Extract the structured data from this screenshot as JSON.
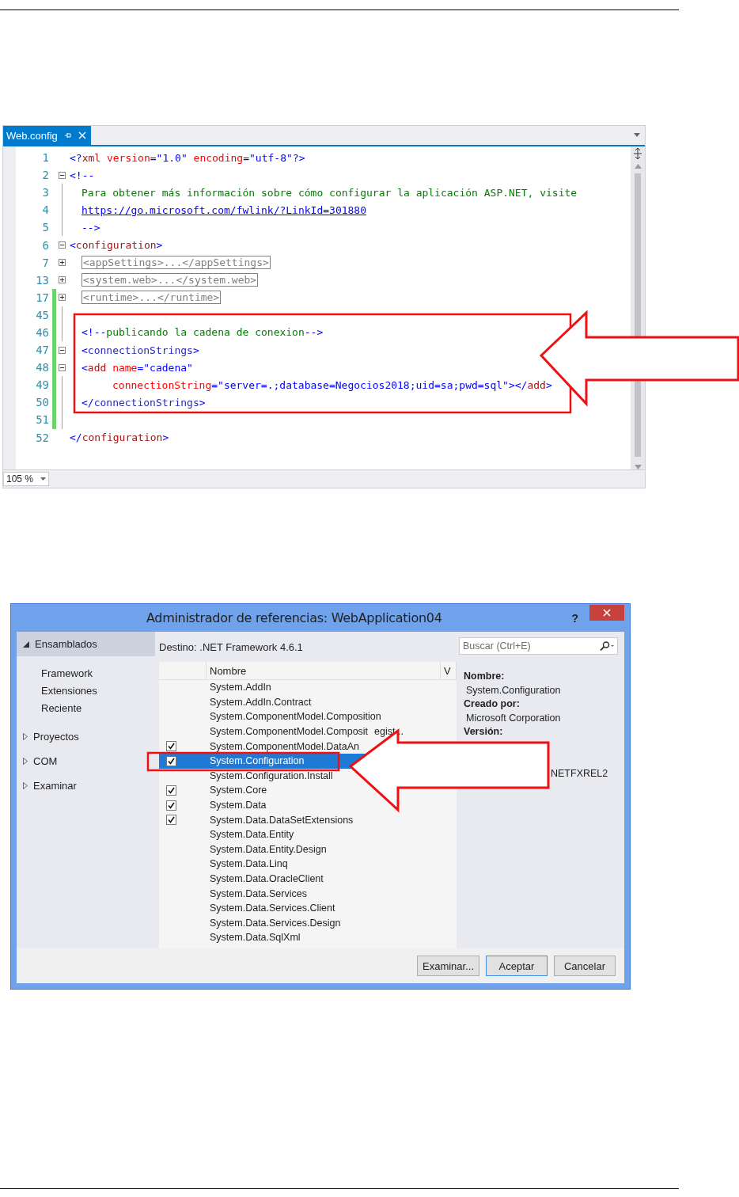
{
  "editor": {
    "tab": {
      "title": "Web.config"
    },
    "zoom": "105 %",
    "lines": [
      {
        "number": "1",
        "kind": "top",
        "changed": false,
        "tokens": [
          {
            "t": "<?",
            "kind": "punct"
          },
          {
            "t": "xml",
            "kind": "element"
          },
          {
            "t": " version",
            "kind": "attr"
          },
          {
            "t": "=\"1.0\"",
            "kind": "value"
          },
          {
            "t": " encoding",
            "kind": "attr"
          },
          {
            "t": "=\"utf-8\"",
            "kind": "value"
          },
          {
            "t": "?>",
            "kind": "punct"
          }
        ]
      },
      {
        "number": "2",
        "kind": "top",
        "expanded": true,
        "changed": false,
        "tokens": [
          {
            "t": "<!--",
            "kind": "punct"
          }
        ]
      },
      {
        "number": "3",
        "kind": "inner",
        "changed": false,
        "tokens": [
          {
            "t": "Para obtener más información sobre cómo configurar la aplicación ASP.NET, visite",
            "kind": "comment"
          }
        ]
      },
      {
        "number": "4",
        "kind": "inner",
        "changed": false,
        "tokens": [
          {
            "t": "https://go.microsoft.com/fwlink/?LinkId=301880",
            "kind": "link"
          }
        ]
      },
      {
        "number": "5",
        "kind": "inner",
        "changed": false,
        "tokens": [
          {
            "t": "-->",
            "kind": "punct"
          }
        ]
      },
      {
        "number": "6",
        "kind": "top",
        "expanded": true,
        "changed": false,
        "tokens": [
          {
            "t": "<",
            "kind": "punct"
          },
          {
            "t": "configuration",
            "kind": "element"
          },
          {
            "t": ">",
            "kind": "punct"
          }
        ]
      },
      {
        "number": "7",
        "kind": "inner",
        "expanded": false,
        "changed": false,
        "tokens": [
          {
            "t": "<appSettings>...</appSettings>",
            "kind": "collapsed"
          }
        ]
      },
      {
        "number": "13",
        "kind": "inner",
        "expanded": false,
        "changed": false,
        "tokens": [
          {
            "t": "<system.web>...</system.web>",
            "kind": "collapsed"
          }
        ]
      },
      {
        "number": "17",
        "kind": "inner",
        "expanded": false,
        "changed": true,
        "tokens": [
          {
            "t": "<runtime>...</runtime>",
            "kind": "collapsed"
          }
        ]
      },
      {
        "number": "45",
        "kind": "inner",
        "changed": true
      },
      {
        "number": "46",
        "kind": "inner",
        "changed": true,
        "tokens": [
          {
            "t": "<!--",
            "kind": "punct"
          },
          {
            "t": "publicando la cadena de conexion",
            "kind": "comment"
          },
          {
            "t": "-->",
            "kind": "punct"
          }
        ]
      },
      {
        "number": "47",
        "kind": "inner",
        "expanded": true,
        "changed": true,
        "tokens": [
          {
            "t": "<",
            "kind": "punct"
          },
          {
            "t": "connectionStrings",
            "kind": "tag"
          },
          {
            "t": ">",
            "kind": "punct"
          }
        ]
      },
      {
        "number": "48",
        "kind": "inner",
        "expanded": true,
        "changed": true,
        "tokens": [
          {
            "t": "<",
            "kind": "punct"
          },
          {
            "t": "add",
            "kind": "element"
          },
          {
            "t": " name",
            "kind": "attr"
          },
          {
            "t": "=\"cadena\"",
            "kind": "value"
          }
        ]
      },
      {
        "number": "49",
        "kind": "continuation",
        "changed": true,
        "tokens": [
          {
            "t": "connectionString",
            "kind": "attr"
          },
          {
            "t": "=\"server=.;database=Negocios2018;uid=sa;pwd=sql\"",
            "kind": "value"
          },
          {
            "t": "></",
            "kind": "punct"
          },
          {
            "t": "add",
            "kind": "element"
          },
          {
            "t": ">",
            "kind": "punct"
          }
        ]
      },
      {
        "number": "50",
        "kind": "inner",
        "changed": true,
        "tokens": [
          {
            "t": "</",
            "kind": "punct"
          },
          {
            "t": "connectionStrings",
            "kind": "tag"
          },
          {
            "t": ">",
            "kind": "punct"
          }
        ]
      },
      {
        "number": "51",
        "kind": "inner",
        "changed": true
      },
      {
        "number": "52",
        "kind": "top",
        "changed": false,
        "tokens": [
          {
            "t": "</",
            "kind": "punct"
          },
          {
            "t": "configuration",
            "kind": "element"
          },
          {
            "t": ">",
            "kind": "punct"
          }
        ]
      }
    ]
  },
  "dialog": {
    "title": "Administrador de referencias: WebApplication04",
    "help": "?",
    "nav": [
      {
        "label": "Ensamblados",
        "expanded": true,
        "selected": true,
        "children": [
          {
            "label": "Framework",
            "selected": false
          },
          {
            "label": "Extensiones",
            "selected": false
          },
          {
            "label": "Reciente",
            "selected": false
          }
        ]
      },
      {
        "label": "Proyectos",
        "expanded": false,
        "selected": false
      },
      {
        "label": "COM",
        "expanded": false,
        "selected": false
      },
      {
        "label": "Examinar",
        "expanded": false,
        "selected": false
      }
    ],
    "target": "Destino: .NET Framework 4.6.1",
    "search": {
      "placeholder": "Buscar (Ctrl+E)"
    },
    "columns": [
      "Nombre",
      "V"
    ],
    "rows": [
      {
        "name": "System.AddIn",
        "checked": false,
        "selected": false
      },
      {
        "name": "System.AddIn.Contract",
        "checked": false,
        "selected": false
      },
      {
        "name": "System.ComponentModel.Composition",
        "checked": false,
        "selected": false
      },
      {
        "name": "System.ComponentModel.Composit",
        "tail": "egist...",
        "checked": false,
        "selected": false
      },
      {
        "name": "System.ComponentModel.DataAn",
        "checked": true,
        "selected": false
      },
      {
        "name": "System.Configuration",
        "checked": true,
        "selected": true
      },
      {
        "name": "System.Configuration.Install",
        "checked": false,
        "selected": false
      },
      {
        "name": "System.Core",
        "checked": true,
        "selected": false
      },
      {
        "name": "System.Data",
        "checked": true,
        "selected": false
      },
      {
        "name": "System.Data.DataSetExtensions",
        "checked": true,
        "selected": false
      },
      {
        "name": "System.Data.Entity",
        "checked": false,
        "selected": false
      },
      {
        "name": "System.Data.Entity.Design",
        "checked": false,
        "selected": false
      },
      {
        "name": "System.Data.Linq",
        "checked": false,
        "selected": false
      },
      {
        "name": "System.Data.OracleClient",
        "checked": false,
        "selected": false
      },
      {
        "name": "System.Data.Services",
        "checked": false,
        "selected": false
      },
      {
        "name": "System.Data.Services.Client",
        "checked": false,
        "selected": false
      },
      {
        "name": "System.Data.Services.Design",
        "checked": false,
        "selected": false
      },
      {
        "name": "System.Data.SqlXml",
        "checked": false,
        "selected": false
      }
    ],
    "details": [
      {
        "label": "Nombre:",
        "value": "System.Configuration"
      },
      {
        "label": "Creado por:",
        "value": "Microsoft Corporation"
      },
      {
        "label": "Versión:"
      },
      {
        "value": "NETFXREL2"
      }
    ],
    "buttons": [
      {
        "label": "Examinar...",
        "default": false
      },
      {
        "label": "Aceptar",
        "default": true
      },
      {
        "label": "Cancelar",
        "default": false
      }
    ]
  }
}
